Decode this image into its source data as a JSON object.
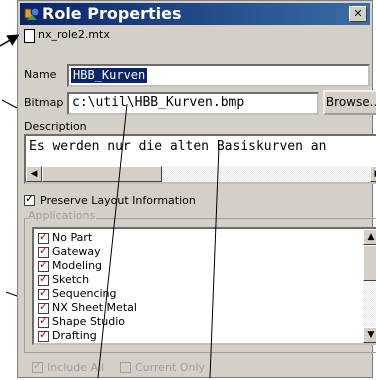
{
  "window": {
    "title": "Role Properties",
    "close_glyph": "✕",
    "icon": "role-icon"
  },
  "file": {
    "name": "nx_role2.mtx",
    "icon": "document-icon"
  },
  "form": {
    "name_label": "Name",
    "name_value": "HBB_Kurven",
    "bitmap_label": "Bitmap",
    "bitmap_value": "c:\\util\\HBB_Kurven.bmp",
    "browse_label": "Browse...",
    "description_label": "Description",
    "description_value": "Es werden nur die alten Basiskurven an",
    "preserve_layout_label": "Preserve Layout Information",
    "preserve_layout_checked": true
  },
  "applications": {
    "legend": "Applications",
    "items": [
      {
        "label": "No Part",
        "checked": true
      },
      {
        "label": "Gateway",
        "checked": true
      },
      {
        "label": "Modeling",
        "checked": true
      },
      {
        "label": "Sketch",
        "checked": true
      },
      {
        "label": "Sequencing",
        "checked": true
      },
      {
        "label": "NX Sheet Metal",
        "checked": true
      },
      {
        "label": "Shape Studio",
        "checked": true
      },
      {
        "label": "Drafting",
        "checked": true
      }
    ],
    "include_all_label": "Include All",
    "current_only_label": "Current Only"
  },
  "scroll_glyphs": {
    "left": "◀",
    "right": "▶",
    "up": "▲",
    "down": "▼"
  },
  "colors": {
    "titlebar": "#0a246a",
    "selection": "#0a246a",
    "check_red": "#c00000"
  }
}
